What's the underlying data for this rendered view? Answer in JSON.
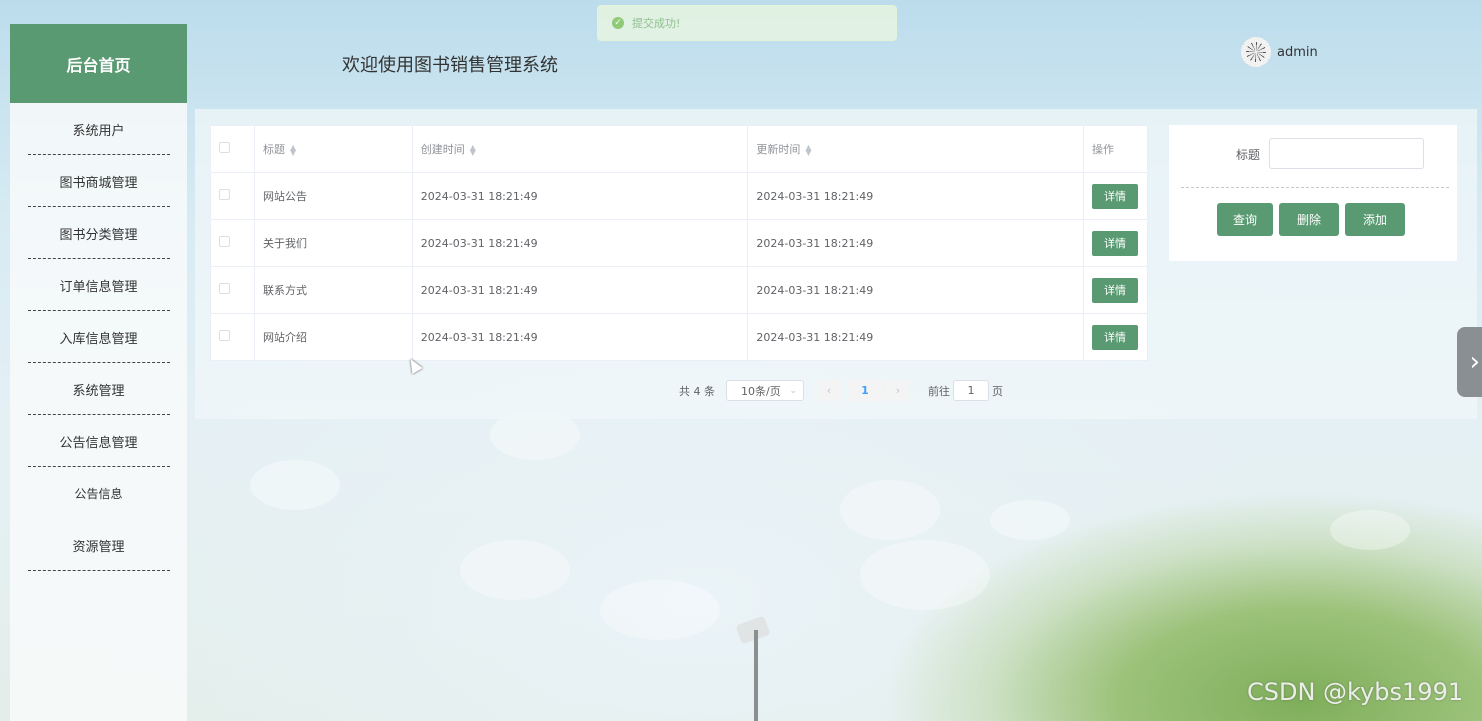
{
  "toast": {
    "message": "提交成功!"
  },
  "header": {
    "title": "欢迎使用图书销售管理系统",
    "username": "admin"
  },
  "sidebar": {
    "brand": "后台首页",
    "items": [
      {
        "label": "系统用户"
      },
      {
        "label": "图书商城管理"
      },
      {
        "label": "图书分类管理"
      },
      {
        "label": "订单信息管理"
      },
      {
        "label": "入库信息管理"
      },
      {
        "label": "系统管理"
      },
      {
        "label": "公告信息管理"
      },
      {
        "label": "公告信息"
      },
      {
        "label": "资源管理"
      }
    ]
  },
  "table": {
    "columns": {
      "title": "标题",
      "created": "创建时间",
      "updated": "更新时间",
      "actions": "操作"
    },
    "rows": [
      {
        "title": "网站公告",
        "created": "2024-03-31 18:21:49",
        "updated": "2024-03-31 18:21:49",
        "action": "详情"
      },
      {
        "title": "关于我们",
        "created": "2024-03-31 18:21:49",
        "updated": "2024-03-31 18:21:49",
        "action": "详情"
      },
      {
        "title": "联系方式",
        "created": "2024-03-31 18:21:49",
        "updated": "2024-03-31 18:21:49",
        "action": "详情"
      },
      {
        "title": "网站介绍",
        "created": "2024-03-31 18:21:49",
        "updated": "2024-03-31 18:21:49",
        "action": "详情"
      }
    ]
  },
  "pagination": {
    "total": "共 4 条",
    "page_size": "10条/页",
    "current_page": "1",
    "goto_label": "前往",
    "goto_value": "1",
    "page_suffix": "页"
  },
  "search": {
    "label": "标题",
    "value": "",
    "query": "查询",
    "delete": "删除",
    "add": "添加"
  },
  "watermark": "CSDN @kybs1991",
  "colors": {
    "primary": "#5a9a72",
    "link": "#409eff"
  }
}
